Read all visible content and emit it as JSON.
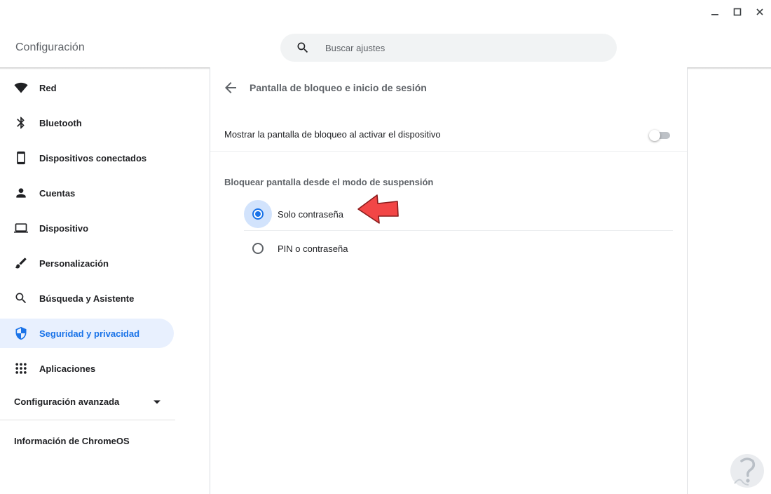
{
  "window": {
    "minimize_icon": "minimize-icon",
    "maximize_icon": "maximize-icon",
    "close_icon": "close-icon"
  },
  "header": {
    "title": "Configuración",
    "search": {
      "placeholder": "Buscar ajustes",
      "value": "",
      "icon": "search-icon"
    }
  },
  "sidebar": {
    "items": [
      {
        "label": "Red",
        "icon": "wifi-icon",
        "active": false
      },
      {
        "label": "Bluetooth",
        "icon": "bluetooth-icon",
        "active": false
      },
      {
        "label": "Dispositivos conectados",
        "icon": "phone-icon",
        "active": false
      },
      {
        "label": "Cuentas",
        "icon": "person-icon",
        "active": false
      },
      {
        "label": "Dispositivo",
        "icon": "laptop-icon",
        "active": false
      },
      {
        "label": "Personalización",
        "icon": "brush-icon",
        "active": false
      },
      {
        "label": "Búsqueda y Asistente",
        "icon": "search-icon",
        "active": false
      },
      {
        "label": "Seguridad y privacidad",
        "icon": "shield-icon",
        "active": true
      },
      {
        "label": "Aplicaciones",
        "icon": "apps-grid-icon",
        "active": false
      }
    ],
    "advanced_label": "Configuración avanzada",
    "about_label": "Información de ChromeOS"
  },
  "main": {
    "page_title": "Pantalla de bloqueo e inicio de sesión",
    "lock_row": {
      "label": "Mostrar la pantalla de bloqueo al activar el dispositivo",
      "toggle_on": false
    },
    "sleep_section": {
      "label": "Bloquear pantalla desde el modo de suspensión",
      "options": [
        {
          "label": "Solo contraseña",
          "selected": true
        },
        {
          "label": "PIN o contraseña",
          "selected": false
        }
      ]
    }
  },
  "colors": {
    "accent": "#1a73e8",
    "active_bg": "#e8f0fe",
    "halo": "#d2e3fc",
    "annotation_arrow": "#f24646"
  }
}
